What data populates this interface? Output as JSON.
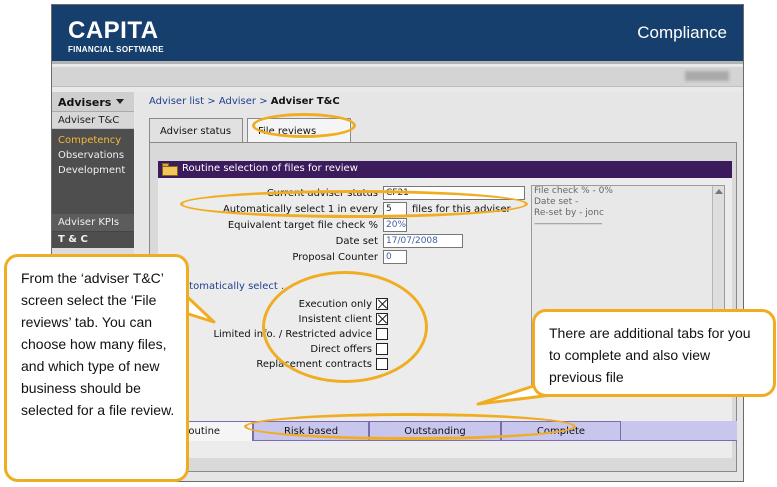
{
  "header": {
    "logo_main": "CAPITA",
    "logo_sub": "FINANCIAL SOFTWARE",
    "app_title": "Compliance",
    "bar_color": "#173f6e"
  },
  "sidebar": {
    "heading": "Advisers",
    "item_tc": "Adviser T&C",
    "sub_items": [
      "Competency",
      "Observations",
      "Development"
    ],
    "active_item": "Competency",
    "kpi": "Adviser KPIs",
    "tc_section": "T & C"
  },
  "breadcrumb": {
    "link1": "Adviser list",
    "link2": "Adviser",
    "current": "Adviser T&C",
    "separator": ">"
  },
  "tabs": {
    "adviser_status": "Adviser status",
    "file_reviews": "File reviews"
  },
  "section": {
    "title": "Routine selection of files for review",
    "icon": "folder-icon",
    "bar_color": "#3b1b5c"
  },
  "form": {
    "current_status_label": "Current adviser status",
    "current_status_value": "CF21",
    "auto_select_label": "Automatically select 1 in every",
    "auto_select_value": "5",
    "auto_select_suffix": "files for this adviser",
    "equiv_label": "Equivalent target file check %",
    "equiv_value": "20%",
    "date_set_label": "Date set",
    "date_set_value": "17/07/2008",
    "proposal_label": "Proposal Counter",
    "proposal_value": "0"
  },
  "info_box": {
    "line1": "File check % - 0%",
    "line2": "Date set -",
    "line3": "Re-set by - jonc",
    "separator": "------------------------------"
  },
  "auto_select": {
    "title": "Automatically select ...",
    "options": [
      {
        "label": "Execution only",
        "checked": true
      },
      {
        "label": "Insistent client",
        "checked": true
      },
      {
        "label": "Limited info. / Restricted advice",
        "checked": false
      },
      {
        "label": "Direct offers",
        "checked": false
      },
      {
        "label": "Replacement contracts",
        "checked": false
      }
    ]
  },
  "bottom_tabs": [
    "Routine",
    "Risk based",
    "Outstanding",
    "Complete"
  ],
  "callouts": {
    "left": "From the ‘adviser T&C’ screen select the ‘File reviews’ tab. You can choose how many files, and which type of new business should be selected for a file review.",
    "right": "There are additional tabs for you to complete and also view previous file",
    "accent_color": "#f0ad22"
  }
}
